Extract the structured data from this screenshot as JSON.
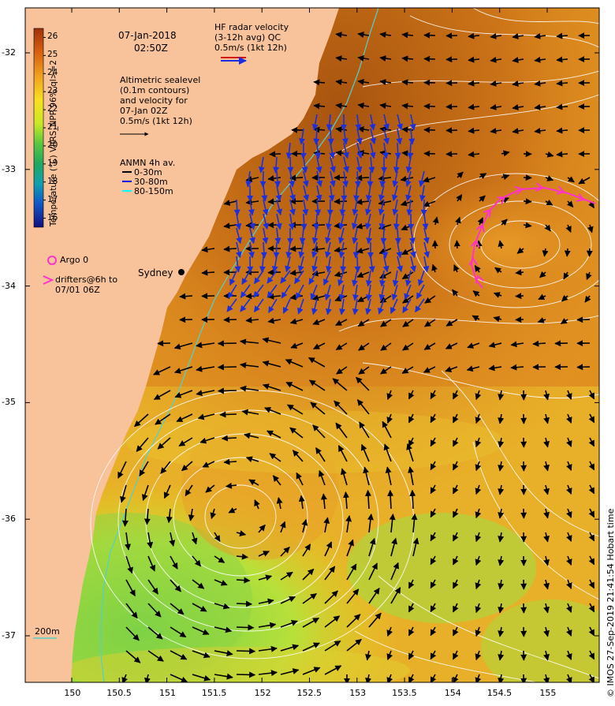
{
  "map": {
    "date": "07-Jan-2018",
    "time": "02:50Z",
    "colorbar": {
      "label": "Temperature (°C) VIIRS_NPP 96% ql>=2",
      "ticks": [
        "26",
        "25",
        "24",
        "23",
        "22",
        "21",
        "20",
        "19",
        "18",
        "17",
        "16"
      ],
      "min": 15.5,
      "max": 26.5
    },
    "altimetric_text": "Altimetric sealevel\n(0.1m contours)\nand velocity for\n07-Jan 02Z\n0.5m/s (1kt 12h)",
    "hf_radar_text": "HF radar velocity\n(3-12h avg) QC\n0.5m/s (1kt 12h)",
    "anmn": {
      "title": "ANMN 4h av.",
      "items": [
        {
          "label": "0-30m",
          "color": "#000000"
        },
        {
          "label": "30-80m",
          "color": "#0000ff"
        },
        {
          "label": "80-150m",
          "color": "#00ffff"
        }
      ]
    },
    "argo_label": "Argo 0",
    "drifters_label": "drifters@6h to\n07/01 06Z",
    "city_label": "Sydney",
    "contour_label": "200m",
    "x_ticks": [
      "150",
      "150.5",
      "151",
      "151.5",
      "152",
      "152.5",
      "153",
      "153.5",
      "154",
      "154.5",
      "155"
    ],
    "y_ticks": [
      "-32",
      "-33",
      "-34",
      "-35",
      "-36",
      "-37"
    ],
    "credit": "© IMOS 27-Sep-2019 21:41:54 Hobart time",
    "colors": {
      "land": "#f8c29a",
      "warm_core": "#b05a14",
      "warm": "#e08820",
      "mid": "#f0c020",
      "cool": "#b8e040",
      "cooler": "#60c850",
      "radar_arrow": "#1a2fe0",
      "drifter": "#ff33cc",
      "argo": "#ff33cc"
    }
  }
}
